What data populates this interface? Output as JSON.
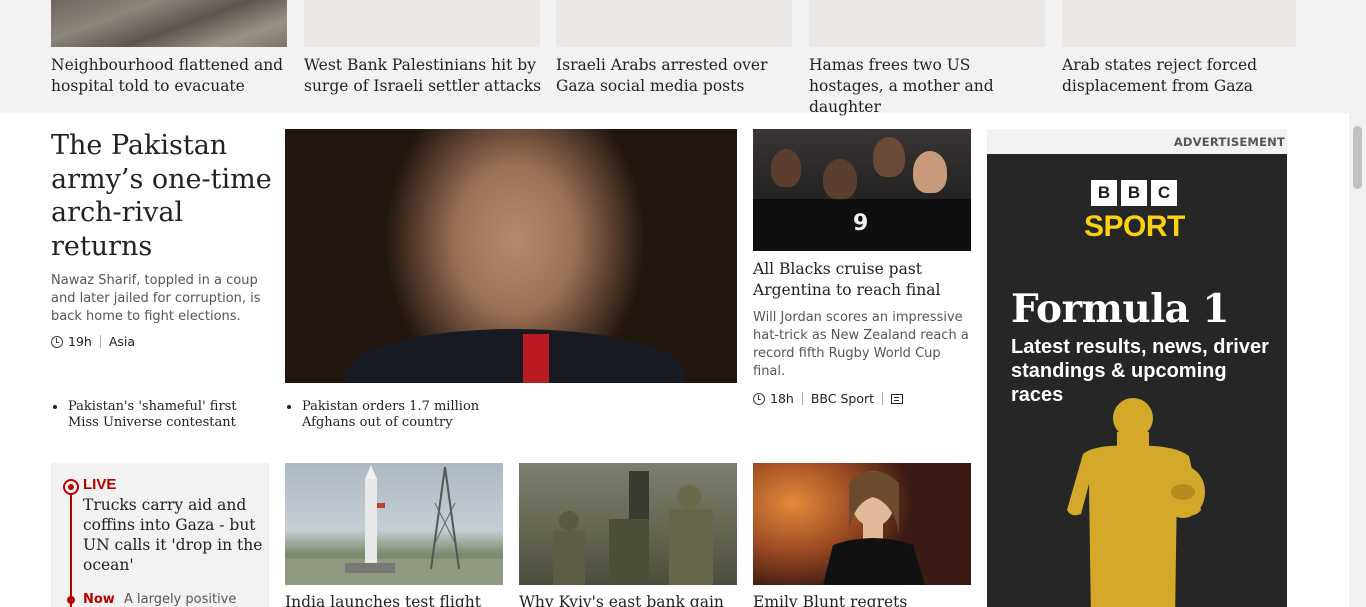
{
  "top_strip": {
    "items": [
      {
        "title": "Neighbourhood flattened and hospital told to evacuate"
      },
      {
        "title": "West Bank Palestinians hit by surge of Israeli settler attacks"
      },
      {
        "title": "Israeli Arabs arrested over Gaza social media posts"
      },
      {
        "title": "Hamas frees two US hostages, a mother and daughter"
      },
      {
        "title": "Arab states reject forced displacement from Gaza"
      }
    ]
  },
  "lead": {
    "title": "The Pakistan army’s one-time arch-rival returns",
    "summary": "Nawaz Sharif, toppled in a coup and later jailed for corruption, is back home to fight elections.",
    "time": "19h",
    "tag": "Asia",
    "related": [
      "Pakistan's 'shameful' first Miss Universe contestant",
      "Pakistan orders 1.7 million Afghans out of country"
    ]
  },
  "sport_story": {
    "title": "All Blacks cruise past Argentina to reach final",
    "summary": "Will Jordan scores an impressive hat-trick as New Zealand reach a record fifth Rugby World Cup final.",
    "time": "18h",
    "tag": "BBC Sport",
    "jersey_number": "9"
  },
  "advert": {
    "label": "ADVERTISEMENT",
    "logo_letters": [
      "B",
      "B",
      "C"
    ],
    "brand": "SPORT",
    "headline": "Formula 1",
    "subline": "Latest results, news, driver standings & upcoming races",
    "brand_color": "#fcd20d",
    "bg_color": "#262626"
  },
  "live": {
    "label": "LIVE",
    "title": "Trucks carry aid and coffins into Gaza - but UN calls it 'drop in the ocean'",
    "now_label": "Now",
    "update": "A largely positive"
  },
  "bottom": [
    {
      "title": "India launches test flight"
    },
    {
      "title": "Why Kyiv's east bank gain"
    },
    {
      "title": "Emily Blunt regrets"
    }
  ],
  "colors": {
    "live_red": "#b80000",
    "strip_bg": "#f2f2f2",
    "text": "#202224",
    "summary_text": "#545658"
  }
}
